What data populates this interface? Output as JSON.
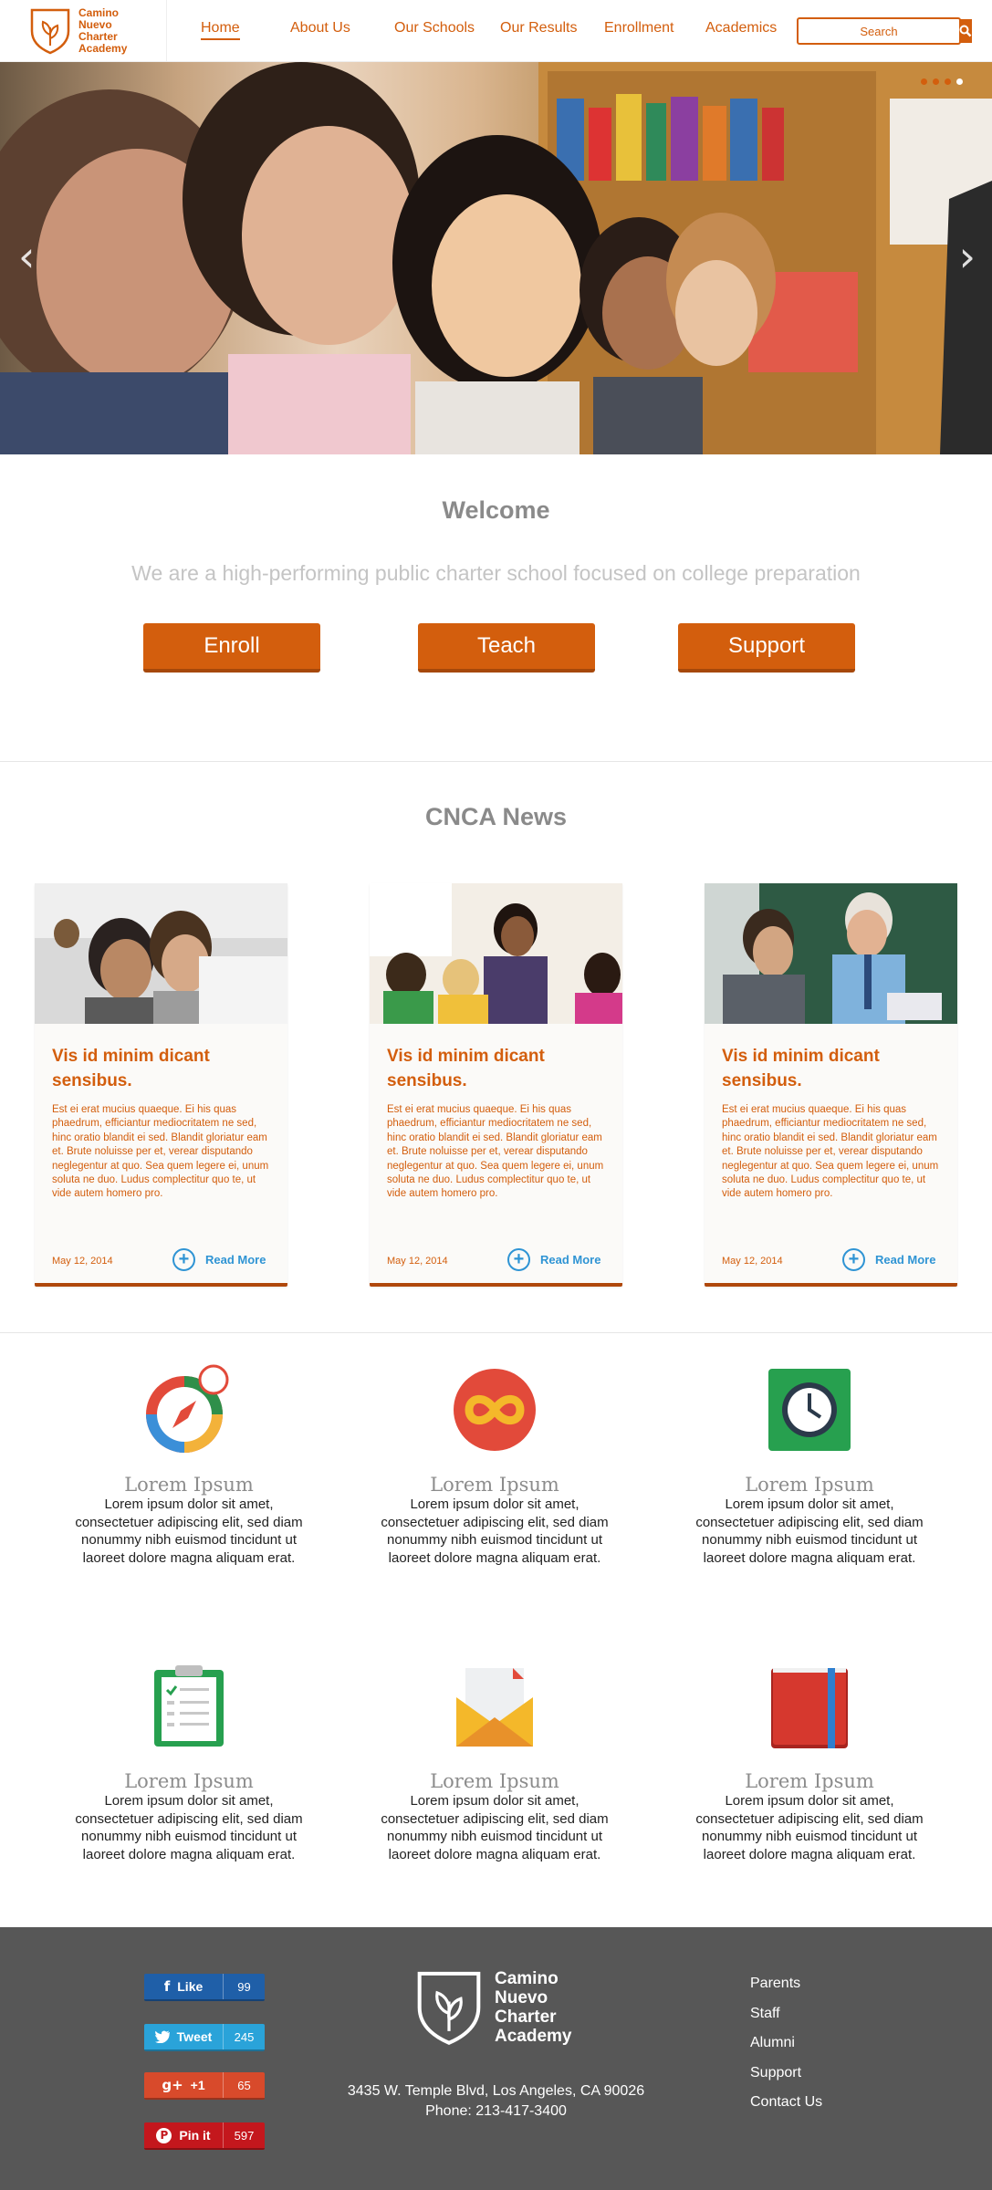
{
  "header": {
    "logo_text": [
      "Camino",
      "Nuevo",
      "Charter",
      "Academy"
    ],
    "nav": [
      {
        "label": "Home",
        "active": true
      },
      {
        "label": "About Us"
      },
      {
        "label": "Our Schools"
      },
      {
        "label": "Our Results"
      },
      {
        "label": "Enrollment"
      },
      {
        "label": "Academics"
      }
    ],
    "search_placeholder": "Search",
    "search_icon": "magnifier-icon"
  },
  "hero": {
    "slide_count": 4,
    "active_slide": 4,
    "prev_icon": "chevron-left-icon",
    "next_icon": "chevron-right-icon"
  },
  "welcome": {
    "title": "Welcome",
    "subtitle": "We are a high-performing public charter school focused on college preparation",
    "buttons": [
      "Enroll",
      "Teach",
      "Support"
    ]
  },
  "news": {
    "title": "CNCA News",
    "cards": [
      {
        "title": "Vis id minim dicant sensibus.",
        "body": "Est ei erat mucius quaeque. Ei his quas phaedrum, efficiantur mediocritatem ne sed, hinc oratio blandit ei sed. Blandit gloriatur eam et. Brute noluisse per et, verear disputando neglegentur at quo. Sea quem legere ei, unum soluta ne duo. Ludus complectitur quo te, ut vide autem homero pro.",
        "date": "May 12, 2014",
        "more": "Read More"
      },
      {
        "title": "Vis id minim dicant sensibus.",
        "body": "Est ei erat mucius quaeque. Ei his quas phaedrum, efficiantur mediocritatem ne sed, hinc oratio blandit ei sed. Blandit gloriatur eam et. Brute noluisse per et, verear disputando neglegentur at quo. Sea quem legere ei, unum soluta ne duo. Ludus complectitur quo te, ut vide autem homero pro.",
        "date": "May 12, 2014",
        "more": "Read More"
      },
      {
        "title": "Vis id minim dicant sensibus.",
        "body": "Est ei erat mucius quaeque. Ei his quas phaedrum, efficiantur mediocritatem ne sed, hinc oratio blandit ei sed. Blandit gloriatur eam et. Brute noluisse per et, verear disputando neglegentur at quo. Sea quem legere ei, unum soluta ne duo. Ludus complectitur quo te, ut vide autem homero pro.",
        "date": "May 12, 2014",
        "more": "Read More"
      }
    ]
  },
  "features": [
    {
      "icon": "compass-icon",
      "title": "Lorem Ipsum",
      "text": "Lorem ipsum dolor sit amet, consectetuer adipiscing elit, sed diam nonummy nibh euismod tincidunt ut laoreet dolore magna aliquam erat."
    },
    {
      "icon": "infinity-icon",
      "title": "Lorem Ipsum",
      "text": "Lorem ipsum dolor sit amet, consectetuer adipiscing elit, sed diam nonummy nibh euismod tincidunt ut laoreet dolore magna aliquam erat."
    },
    {
      "icon": "clock-icon",
      "title": "Lorem Ipsum",
      "text": "Lorem ipsum dolor sit amet, consectetuer adipiscing elit, sed diam nonummy nibh euismod tincidunt ut laoreet dolore magna aliquam erat."
    },
    {
      "icon": "clipboard-icon",
      "title": "Lorem Ipsum",
      "text": "Lorem ipsum dolor sit amet, consectetuer adipiscing elit, sed diam nonummy nibh euismod tincidunt ut laoreet dolore magna aliquam erat."
    },
    {
      "icon": "envelope-icon",
      "title": "Lorem Ipsum",
      "text": "Lorem ipsum dolor sit amet, consectetuer adipiscing elit, sed diam nonummy nibh euismod tincidunt ut laoreet dolore magna aliquam erat."
    },
    {
      "icon": "book-icon",
      "title": "Lorem Ipsum",
      "text": "Lorem ipsum dolor sit amet, consectetuer adipiscing elit, sed diam nonummy nibh euismod tincidunt ut laoreet dolore magna aliquam erat."
    }
  ],
  "footer": {
    "social": [
      {
        "name": "facebook",
        "label": "Like",
        "count": "99",
        "icon": "f",
        "color": "#1f5fa8"
      },
      {
        "name": "twitter",
        "label": "Tweet",
        "count": "245",
        "icon": "🐦",
        "color": "#2aa3d9"
      },
      {
        "name": "google-plus",
        "label": "+1",
        "count": "65",
        "icon": "g+",
        "color": "#d84a2b"
      },
      {
        "name": "pinterest",
        "label": "Pin it",
        "count": "597",
        "icon": "P",
        "color": "#c4171d"
      }
    ],
    "logo_text": [
      "Camino",
      "Nuevo",
      "Charter",
      "Academy"
    ],
    "address": "3435 W. Temple Blvd, Los Angeles, CA 90026",
    "phone": "Phone: 213-417-3400",
    "links": [
      "Parents",
      "Staff",
      "Alumni",
      "Support",
      "Contact Us"
    ]
  },
  "colors": {
    "brand_orange": "#d35e0d",
    "link_blue": "#2f94d4",
    "footer_bg": "#575757"
  }
}
